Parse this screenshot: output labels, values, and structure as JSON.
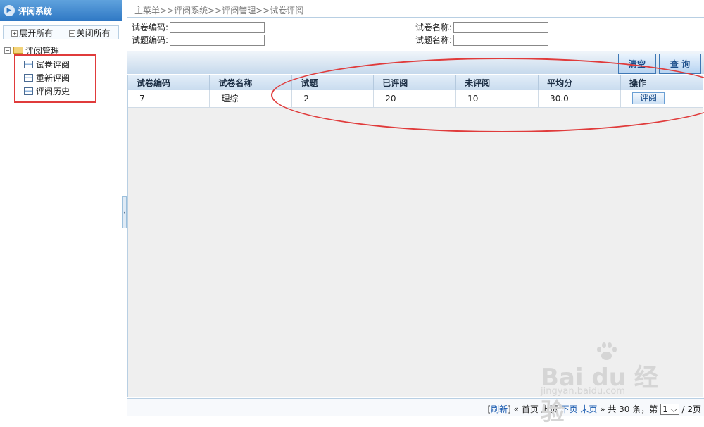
{
  "sidebar": {
    "title": "评阅系统",
    "expand_all": "展开所有",
    "collapse_all": "关闭所有",
    "tree_root": "评阅管理",
    "items": [
      {
        "label": "试卷评阅"
      },
      {
        "label": "重新评阅"
      },
      {
        "label": "评阅历史"
      }
    ]
  },
  "breadcrumb": "主菜单>>评阅系统>>评阅管理>>试卷评阅",
  "search": {
    "paper_code_label": "试卷编码:",
    "question_code_label": "试题编码:",
    "paper_name_label": "试卷名称:",
    "question_name_label": "试题名称:",
    "paper_code_value": "",
    "question_code_value": "",
    "paper_name_value": "",
    "question_name_value": ""
  },
  "buttons": {
    "clear": "清空",
    "query": "查 询"
  },
  "table": {
    "headers": [
      "试卷编码",
      "试卷名称",
      "试题",
      "已评阅",
      "未评阅",
      "平均分",
      "操作"
    ],
    "rows": [
      {
        "paper_code": "7",
        "paper_name": "理综",
        "question": "2",
        "reviewed": "20",
        "unreviewed": "10",
        "avg": "30.0",
        "action": "评阅"
      }
    ]
  },
  "pager": {
    "refresh": "刷新",
    "first": "首页",
    "prev": "上页",
    "next": "下页",
    "last": "末页",
    "total_text": "共 30 条，第",
    "page": "1",
    "pages_text": "/ 2页"
  },
  "watermark": {
    "brand": "Bai du 经验",
    "url": "jingyan.baidu.com"
  },
  "colors": {
    "accent": "#2f78c4",
    "highlight": "#e03b3b"
  }
}
